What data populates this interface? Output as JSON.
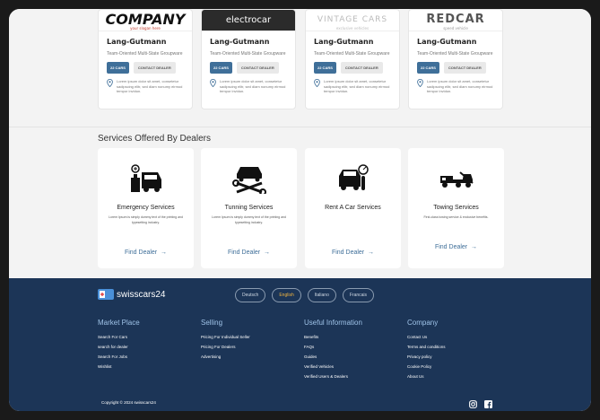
{
  "dealers": [
    {
      "logo": "COMPANY",
      "logo_tagline": "your slogan here",
      "name": "Lang-Gutmann",
      "subtitle": "Team-Oriented Multi-State Groupware",
      "cars_label": "22 CARS",
      "contact_label": "CONTACT DEALER",
      "address": "Lorem ipsum dolor sit amet, consetetur sadipscing elitr, sed diam nonumy eirmod tempor invidun."
    },
    {
      "logo": "electrocar",
      "logo_tagline": "",
      "name": "Lang-Gutmann",
      "subtitle": "Team-Oriented Multi-State Groupware",
      "cars_label": "22 CARS",
      "contact_label": "CONTACT DEALER",
      "address": "Lorem ipsum dolor sit amet, consetetur sadipscing elitr, sed diam nonumy eirmod tempor invidun."
    },
    {
      "logo": "VINTAGE CARS",
      "logo_tagline": "exclusive vehicles",
      "name": "Lang-Gutmann",
      "subtitle": "Team-Oriented Multi-State Groupware",
      "cars_label": "22 CARS",
      "contact_label": "CONTACT DEALER",
      "address": "Lorem ipsum dolor sit amet, consetetur sadipscing elitr, sed diam nonumy eirmod tempor invidun."
    },
    {
      "logo": "REDCAR",
      "logo_tagline": "speed vehicle",
      "name": "Lang-Gutmann",
      "subtitle": "Team-Oriented Multi-State Groupware",
      "cars_label": "22 CARS",
      "contact_label": "CONTACT DEALER",
      "address": "Lorem ipsum dolor sit amet, consetetur sadipscing elitr, sed diam nonumy eirmod tempor invidun."
    }
  ],
  "services": {
    "title": "Services Offered By Dealers",
    "items": [
      {
        "name": "Emergency Services",
        "desc": "Lorem Ipsum is simply dummy text of the printing and typesetting industry.",
        "link": "Find Dealer",
        "icon": "mechanic-car-icon"
      },
      {
        "name": "Tunning Services",
        "desc": "Lorem Ipsum is simply dummy text of the printing and typesetting industry.",
        "link": "Find Dealer",
        "icon": "car-tools-icon"
      },
      {
        "name": "Rent A Car Services",
        "desc": "",
        "link": "Find Dealer",
        "icon": "car-key-icon"
      },
      {
        "name": "Towing Services",
        "desc": "First-class towing service & exclusive benefits.",
        "link": "Find Dealer",
        "icon": "tow-truck-icon"
      }
    ]
  },
  "footer": {
    "logo_text": "swisscars24",
    "languages": [
      "Deutsch",
      "English",
      "Italiano",
      "Francais"
    ],
    "active_language": "English",
    "columns": [
      {
        "title": "Market Place",
        "links": [
          "Search For Cars",
          "search for dealer",
          "Search For Jobs",
          "Wishlist"
        ]
      },
      {
        "title": "Selling",
        "links": [
          "Pricing For Individual Seller",
          "Pricing For Dealers",
          "Advertising"
        ]
      },
      {
        "title": "Useful Information",
        "links": [
          "Benefits",
          "FAQs",
          "Guides",
          "Verified Vehicles",
          "Verified Users & Dealers"
        ]
      },
      {
        "title": "Company",
        "links": [
          "Contact Us",
          "Terms and conditions",
          "Privacy policy",
          "Cookie Policy",
          "About Us"
        ]
      }
    ],
    "copyright": "Copyright © 2024 swisscars24",
    "social": [
      "instagram-icon",
      "facebook-icon"
    ]
  },
  "colors": {
    "accent": "#3f6f99",
    "footer_bg": "#1c3557",
    "footer_heading": "#9fc3e8",
    "active_lang": "#f0b441"
  }
}
